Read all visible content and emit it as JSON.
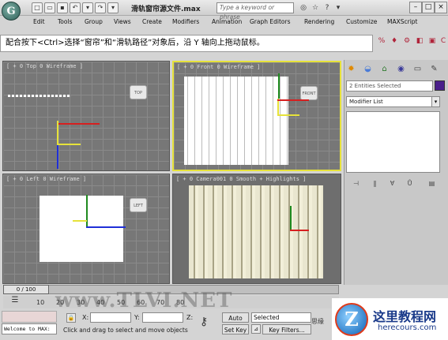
{
  "window": {
    "title": "滑轨窗帘源文件.max",
    "search_placeholder": "Type a keyword or phrase"
  },
  "menu": {
    "items": [
      "Edit",
      "Tools",
      "Group",
      "Views",
      "Create",
      "Modifiers",
      "Animation",
      "Graph Editors",
      "Rendering",
      "Customize",
      "MAXScript"
    ]
  },
  "instruction": "配合按下<Ctrl>选择“窗帘”和“滑轨路径”对象后，沿 Y 轴向上拖动鼠标。",
  "viewports": {
    "top": {
      "label": "[ + 0 Top 0 Wireframe ]",
      "cube": "TOP"
    },
    "front": {
      "label": "[ + 0 Front 0 Wireframe ]",
      "cube": "FRONT"
    },
    "left": {
      "label": "[ + 0 Left 0 Wireframe ]",
      "cube": "LEFT"
    },
    "camera": {
      "label": "[ + 0 Camera001 0 Smooth + Highlights ]"
    }
  },
  "command_panel": {
    "selection_count": "2 Entities Selected",
    "selection_color": "#4a1f8a",
    "modifier_list": "Modifier List"
  },
  "timeline": {
    "frame": "0 / 100",
    "ticks": [
      "10",
      "20",
      "30",
      "40",
      "50",
      "60",
      "70",
      "80"
    ]
  },
  "status": {
    "welcome": "Welcome to MAX:",
    "prompt": "Click and drag to select and move objects",
    "x_label": "X:",
    "y_label": "Y:",
    "z_label": "Z:",
    "auto_key": "Auto Key",
    "set_key": "Set Key",
    "selected": "Selected",
    "key_filters": "Key Filters..."
  },
  "watermark": {
    "center": "www.TLVI.NET",
    "brand_cn": "这里教程网",
    "brand_url": "herecours.com",
    "small": "思缘"
  }
}
